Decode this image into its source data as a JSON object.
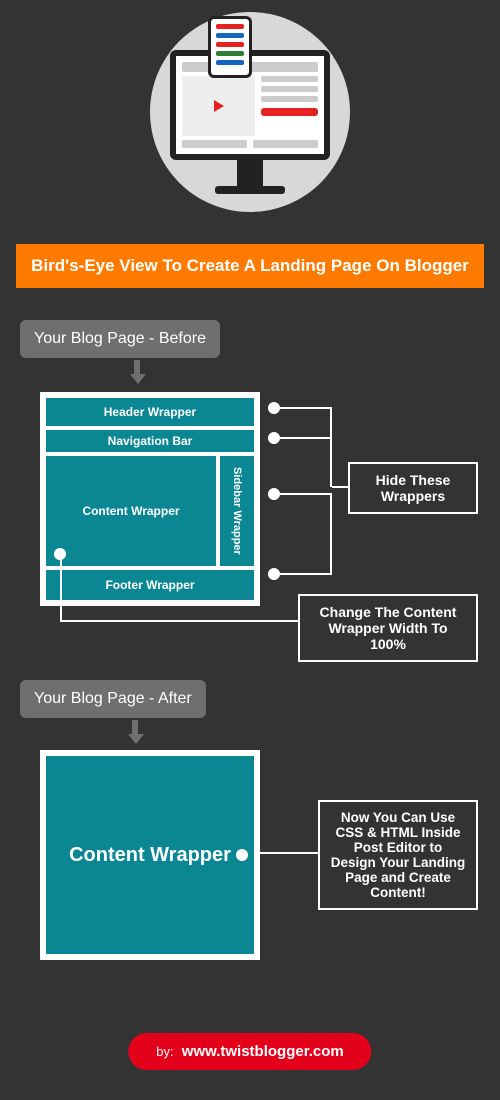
{
  "title": "Bird's-Eye View To Create A Landing Page On Blogger",
  "tags": {
    "before": "Your Blog Page - Before",
    "after": "Your Blog Page - After"
  },
  "before": {
    "header": "Header Wrapper",
    "nav": "Navigation Bar",
    "content": "Content Wrapper",
    "sidebar": "Sidebar Wrapper",
    "footer": "Footer Wrapper"
  },
  "after": {
    "content": "Content Wrapper"
  },
  "callouts": {
    "hide": "Hide These Wrappers",
    "width": "Change The Content Wrapper Width To 100%",
    "design": "Now You Can Use CSS & HTML Inside Post Editor to Design Your Landing Page and Create Content!"
  },
  "badge": {
    "by": "by:",
    "site": "www.twistblogger.com"
  },
  "colors": {
    "bg": "#333333",
    "accent": "#ff7a00",
    "teal": "#0b8793",
    "tag": "#6f6f6f",
    "badge": "#e3001b"
  }
}
